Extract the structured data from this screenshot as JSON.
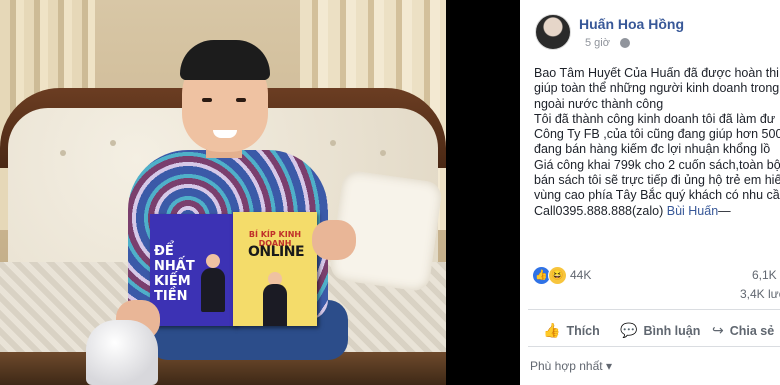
{
  "post": {
    "author": "Huấn Hoa Hồng",
    "time": "5 giờ",
    "visibility_icon": "globe-icon",
    "lines": [
      "Bao Tâm Huyết Của Huấn đã được hoàn thi",
      "giúp toàn thể những người kinh doanh trong",
      "ngoài nước thành công",
      "Tôi đã thành công kinh doanh tôi đã làm đư",
      "Công Ty FB ,của tôi cũng đang giúp hơn 500",
      "đang bán hàng kiếm đc lợi nhuận khổng lồ",
      "Giá công khai 799k cho 2 cuốn sách,toàn bộ",
      "bán sách tôi sẽ trực tiếp đi ủng hộ trẻ em hiế",
      "vùng cao phía Tây Bắc quý khách có nhu cầ"
    ],
    "last_line_text": "Call0395.888.888(zalo) ",
    "last_line_link": "Bùi Huấn",
    "last_line_tail": "—"
  },
  "reactions": {
    "count": "44K",
    "comments": "6,1K",
    "shares": "3,4K lượ"
  },
  "actions": {
    "like": "Thích",
    "comment": "Bình luận",
    "share": "Chia sẻ"
  },
  "comments_sort": "Phù hợp nhất",
  "photo": {
    "book1_title": "ĐỂ NHẤT KIẾM TIỀN",
    "book2_title": "BÍ KÍP KINH DOANH",
    "book2_subtitle": "ONLINE"
  },
  "colors": {
    "link": "#385898",
    "like_blue": "#2f72e6",
    "haha_yellow": "#f7c53d"
  }
}
